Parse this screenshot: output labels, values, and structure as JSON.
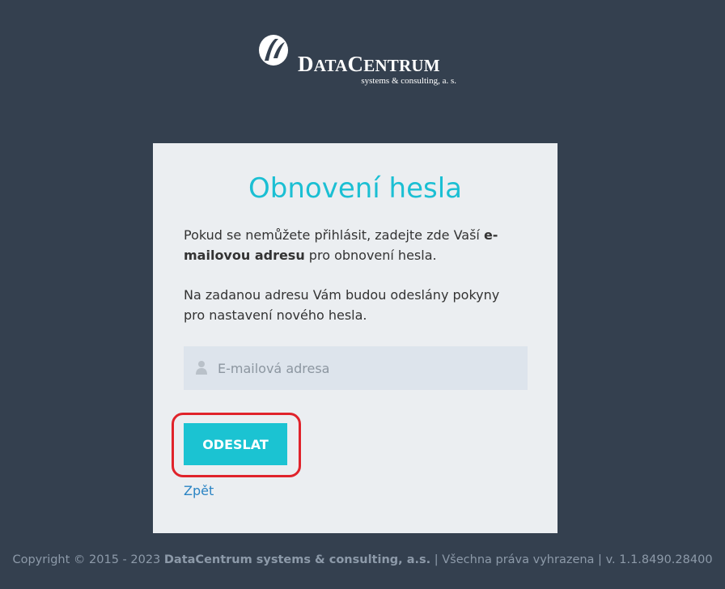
{
  "logo": {
    "name": "DATACENTRUM",
    "name_part1_big": "D",
    "name_part1_small": "ATA",
    "name_part2_big": "C",
    "name_part2_small": "ENTRUM",
    "subtitle": "systems & consulting, a. s.",
    "icon": "datacentrum-logo-mark"
  },
  "card": {
    "title": "Obnovení hesla",
    "paragraph1_before": "Pokud se nemůžete přihlásit, zadejte zde Vaší ",
    "paragraph1_bold": "e-mailovou adresu",
    "paragraph1_after": " pro obnovení hesla.",
    "paragraph2": "Na zadanou adresu Vám budou odeslány pokyny pro nastavení nového hesla.",
    "email_placeholder": "E-mailová adresa",
    "email_value": "",
    "email_icon": "user-icon",
    "submit_label": "ODESLAT",
    "back_label": "Zpět"
  },
  "footer": {
    "copyright": "Copyright © 2015 - 2023 ",
    "company": "DataCentrum systems & consulting, a.s.",
    "separator1": " | ",
    "rights": "Všechna práva vyhrazena",
    "separator2": " | ",
    "version": "v. 1.1.8490.28400"
  },
  "colors": {
    "background": "#34404f",
    "card": "#ebeef1",
    "accent": "#1bc3d2",
    "link": "#2a84c4",
    "highlight": "#e0232b"
  }
}
